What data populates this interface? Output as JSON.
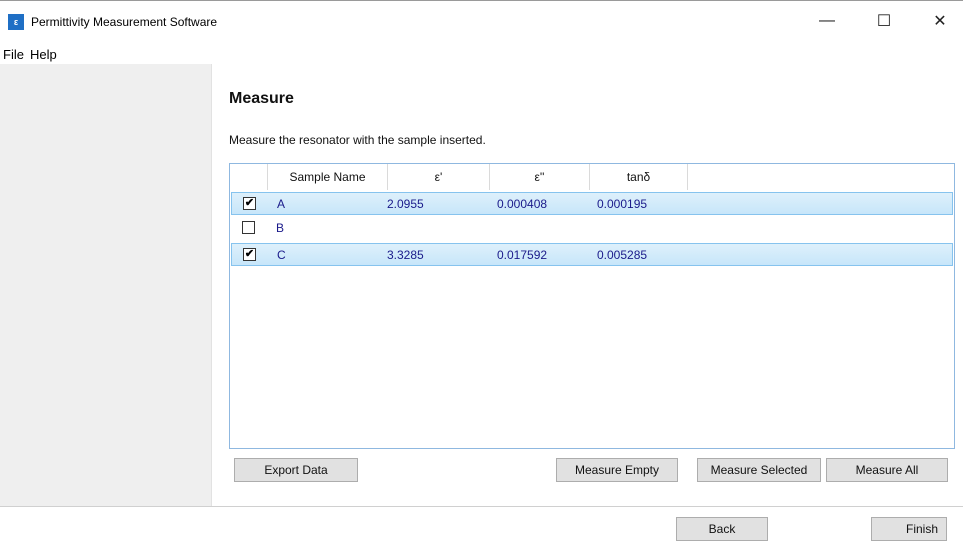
{
  "window": {
    "title": "Permittivity Measurement Software",
    "icon_label": "ε",
    "min_glyph": "—",
    "max_glyph": "☐",
    "close_glyph": "✕"
  },
  "menu": {
    "file": "File",
    "help": "Help"
  },
  "page": {
    "heading": "Measure",
    "instructions": "Measure the resonator with the sample inserted."
  },
  "table": {
    "columns": [
      "Sample Name",
      "ε'",
      "ε''",
      "tanδ"
    ],
    "rows": [
      {
        "checked": "✔",
        "name": "A",
        "eps1": "2.0955",
        "eps2": "0.000408",
        "tan": "0.000195"
      },
      {
        "checked": "",
        "name": "B",
        "eps1": "",
        "eps2": "",
        "tan": ""
      },
      {
        "checked": "✔",
        "name": "C",
        "eps1": "3.3285",
        "eps2": "0.017592",
        "tan": "0.005285"
      }
    ]
  },
  "buttons": {
    "export": "Export Data",
    "measure_empty": "Measure Empty",
    "measure_selected": "Measure Selected",
    "measure_all": "Measure All",
    "back": "Back",
    "finish": "Finish"
  }
}
